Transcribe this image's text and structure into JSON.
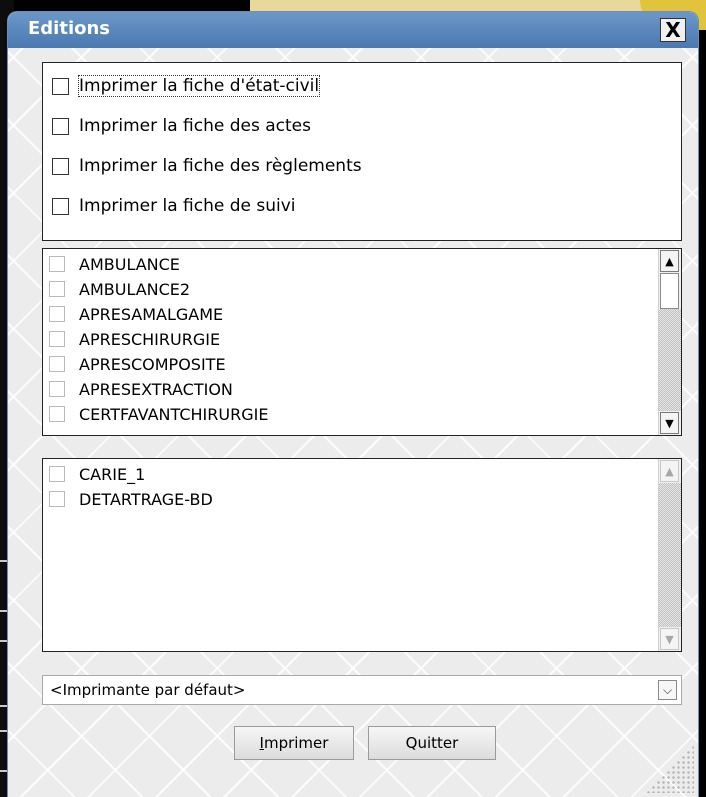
{
  "dialog": {
    "title": "Editions",
    "close_glyph": "X"
  },
  "options": [
    {
      "label": "Imprimer la fiche d'état-civil",
      "checked": false,
      "focused": true
    },
    {
      "label": "Imprimer la fiche des actes",
      "checked": false
    },
    {
      "label": "Imprimer la fiche des règlements",
      "checked": false
    },
    {
      "label": "Imprimer la fiche de suivi",
      "checked": false
    }
  ],
  "list1": {
    "items": [
      "AMBULANCE",
      "AMBULANCE2",
      "APRESAMALGAME",
      "APRESCHIRURGIE",
      "APRESCOMPOSITE",
      "APRESEXTRACTION",
      "CERTFAVANTCHIRURGIE"
    ]
  },
  "list2": {
    "items": [
      "CARIE_1",
      "DETARTRAGE-BD"
    ]
  },
  "printer": {
    "selected": "<Imprimante par défaut>"
  },
  "buttons": {
    "print_label": "Imprimer",
    "quit_label": "Quitter"
  },
  "icons": {
    "close": "close-icon",
    "scroll_up": "arrow-up-icon",
    "scroll_down": "arrow-down-icon",
    "dropdown": "chevron-down-icon"
  }
}
